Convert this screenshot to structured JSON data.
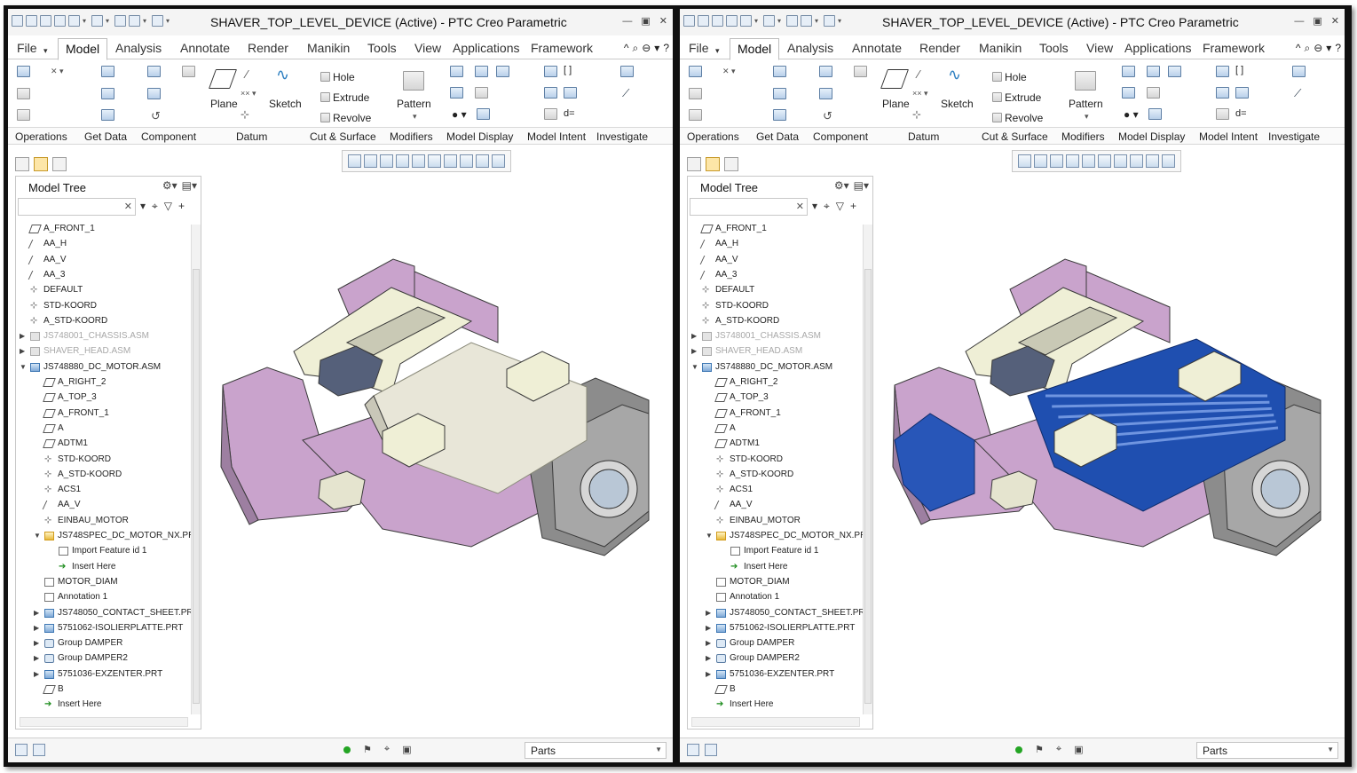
{
  "windows": [
    {
      "id": "left",
      "title": "SHAVER_TOP_LEVEL_DEVICE (Active) - PTC Creo Parametric",
      "motor_color": "#e8e6d8",
      "motor_style": "plain"
    },
    {
      "id": "right",
      "title": "SHAVER_TOP_LEVEL_DEVICE (Active) - PTC Creo Parametric",
      "motor_color": "#1f4fb0",
      "motor_style": "ribbed"
    }
  ],
  "menu": {
    "tabs": [
      "File",
      "Model",
      "Analysis",
      "Annotate",
      "Render",
      "Manikin",
      "Tools",
      "View",
      "Applications",
      "Framework"
    ],
    "active": "Model",
    "right_icons": [
      "^",
      "⌕",
      "⊖",
      "▾",
      "?"
    ]
  },
  "ribbon": {
    "plane": "Plane",
    "sketch": "Sketch",
    "hole": "Hole",
    "extrude": "Extrude",
    "revolve": "Revolve",
    "pattern": "Pattern"
  },
  "groups": [
    "Operations",
    "Get Data",
    "Component",
    "Datum",
    "Cut & Surface",
    "Modifiers",
    "Model Display",
    "Model Intent",
    "Investigate"
  ],
  "model_tree": {
    "title": "Model Tree",
    "rows": [
      {
        "label": "A_FRONT_1",
        "icon": "plane",
        "depth": 0,
        "expander": ""
      },
      {
        "label": "AA_H",
        "icon": "axis",
        "depth": 0,
        "expander": ""
      },
      {
        "label": "AA_V",
        "icon": "axis",
        "depth": 0,
        "expander": ""
      },
      {
        "label": "AA_3",
        "icon": "axis",
        "depth": 0,
        "expander": ""
      },
      {
        "label": "DEFAULT",
        "icon": "csys",
        "depth": 0,
        "expander": ""
      },
      {
        "label": "STD-KOORD",
        "icon": "csys",
        "depth": 0,
        "expander": ""
      },
      {
        "label": "A_STD-KOORD",
        "icon": "csys",
        "depth": 0,
        "expander": ""
      },
      {
        "label": "JS748001_CHASSIS.ASM",
        "icon": "asmgrey",
        "depth": 0,
        "expander": "▶",
        "dim": true
      },
      {
        "label": "SHAVER_HEAD.ASM",
        "icon": "asmgrey",
        "depth": 0,
        "expander": "▶",
        "dim": true
      },
      {
        "label": "JS748880_DC_MOTOR.ASM",
        "icon": "asm",
        "depth": 0,
        "expander": "▼"
      },
      {
        "label": "A_RIGHT_2",
        "icon": "plane",
        "depth": 1,
        "expander": ""
      },
      {
        "label": "A_TOP_3",
        "icon": "plane",
        "depth": 1,
        "expander": ""
      },
      {
        "label": "A_FRONT_1",
        "icon": "plane",
        "depth": 1,
        "expander": ""
      },
      {
        "label": "A",
        "icon": "plane",
        "depth": 1,
        "expander": ""
      },
      {
        "label": "ADTM1",
        "icon": "plane",
        "depth": 1,
        "expander": ""
      },
      {
        "label": "STD-KOORD",
        "icon": "csys",
        "depth": 1,
        "expander": ""
      },
      {
        "label": "A_STD-KOORD",
        "icon": "csys",
        "depth": 1,
        "expander": ""
      },
      {
        "label": "ACS1",
        "icon": "csys",
        "depth": 1,
        "expander": ""
      },
      {
        "label": "AA_V",
        "icon": "axis",
        "depth": 1,
        "expander": ""
      },
      {
        "label": "EINBAU_MOTOR",
        "icon": "csys",
        "depth": 1,
        "expander": ""
      },
      {
        "label": "JS748SPEC_DC_MOTOR_NX.PR",
        "icon": "part",
        "depth": 1,
        "expander": "▼"
      },
      {
        "label": "Import Feature id 1",
        "icon": "note",
        "depth": 2,
        "expander": ""
      },
      {
        "label": "Insert Here",
        "icon": "insert",
        "depth": 2,
        "expander": ""
      },
      {
        "label": "MOTOR_DIAM",
        "icon": "note",
        "depth": 1,
        "expander": ""
      },
      {
        "label": "Annotation 1",
        "icon": "note",
        "depth": 1,
        "expander": ""
      },
      {
        "label": "JS748050_CONTACT_SHEET.PR",
        "icon": "asm",
        "depth": 1,
        "expander": "▶"
      },
      {
        "label": "5751062-ISOLIERPLATTE.PRT",
        "icon": "asm",
        "depth": 1,
        "expander": "▶"
      },
      {
        "label": "Group DAMPER",
        "icon": "group",
        "depth": 1,
        "expander": "▶"
      },
      {
        "label": "Group DAMPER2",
        "icon": "group",
        "depth": 1,
        "expander": "▶"
      },
      {
        "label": "5751036-EXZENTER.PRT",
        "icon": "asm",
        "depth": 1,
        "expander": "▶"
      },
      {
        "label": "B",
        "icon": "plane",
        "depth": 1,
        "expander": ""
      },
      {
        "label": "Insert Here",
        "icon": "insert",
        "depth": 1,
        "expander": ""
      }
    ]
  },
  "status": {
    "filter": "Parts"
  },
  "colors": {
    "housing": "#c9a3cc",
    "frame": "#8c8c8c",
    "cream": "#efefd6",
    "motor_blue": "#1f4fb0"
  }
}
